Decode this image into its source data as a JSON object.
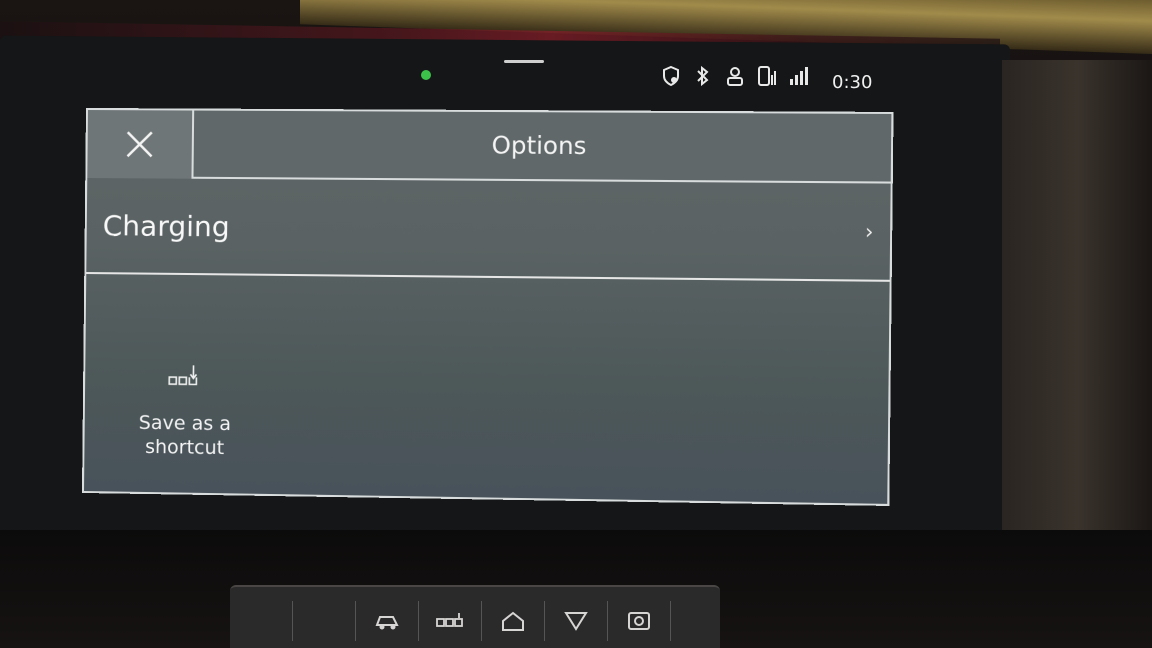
{
  "status_bar": {
    "time": "0:30",
    "icons": [
      "shield-location-icon",
      "bluetooth-icon",
      "user-icon",
      "phone-icon",
      "signal-icon"
    ]
  },
  "dialog": {
    "title": "Options",
    "close_icon": "close-icon",
    "rows": [
      {
        "label": "Charging",
        "chevron": "›"
      }
    ],
    "shortcut": {
      "label_line1": "Save as a",
      "label_line2": "shortcut",
      "icon": "save-shortcut-icon"
    }
  },
  "console": {
    "buttons": [
      "car-icon",
      "apps-icon",
      "home-icon",
      "hazard-icon",
      "power-icon"
    ]
  },
  "colors": {
    "dialog_bg": "#5a6263",
    "border": "#d8dcdc",
    "text": "#f4f4f4",
    "status_dot": "#3cc24a"
  }
}
